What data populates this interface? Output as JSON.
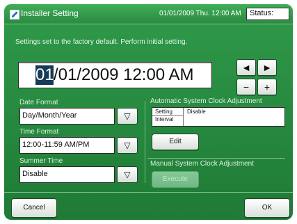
{
  "window": {
    "title": "Installer Setting",
    "datetime": "01/01/2009 Thu. 12:00 AM",
    "status_label": "Status:"
  },
  "main": {
    "message": "Settings set to the factory default. Perform initial setting.",
    "clock": {
      "selected_segment": "01",
      "rest": "/01/2009 12:00 AM"
    },
    "spin_buttons": {
      "left": "◄",
      "right": "►",
      "minus": "−",
      "plus": "+"
    },
    "date_format": {
      "label": "Date Format",
      "value": "Day/Month/Year"
    },
    "time_format": {
      "label": "Time Format",
      "value": "12:00-11:59 AM/PM"
    },
    "summer_time": {
      "label": "Summer Time",
      "value": "Disable"
    },
    "dropdown_glyph": "▽",
    "auto_adjust": {
      "label": "Automatic System Clock Adjustment",
      "setting_label": "Setting",
      "interval_label": "Interval",
      "setting_value": "Disable",
      "edit_label": "Edit"
    },
    "manual_adjust": {
      "label": "Manual System Clock Adjustment",
      "execute_label": "Execute"
    }
  },
  "footer": {
    "cancel_label": "Cancel",
    "ok_label": "OK"
  },
  "colors": {
    "panel": "#2f9a4a",
    "accent": "#163a57"
  },
  "icons": {
    "title": "pencil-icon"
  }
}
